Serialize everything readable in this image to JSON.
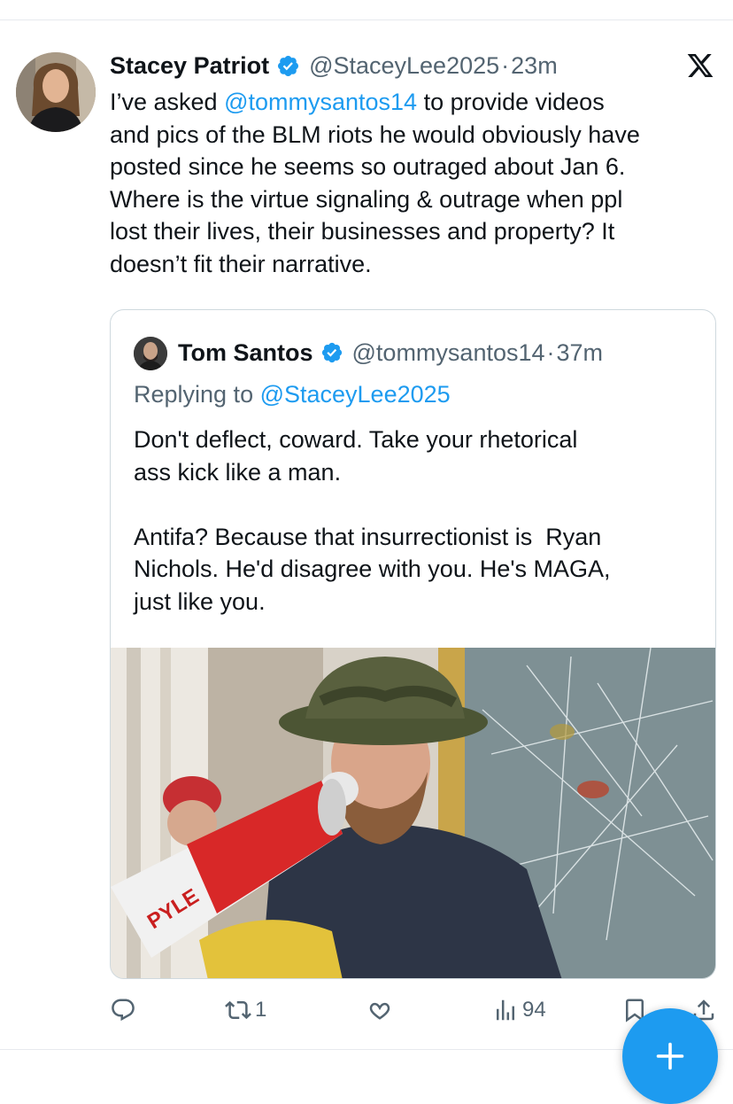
{
  "tweet": {
    "author_name": "Stacey Patriot",
    "author_handle": "@StaceyLee2025",
    "separator": "·",
    "time": "23m",
    "text_before_mention": "I’ve asked ",
    "mention": "@tommysantos14",
    "text_after_mention": " to provide videos\nand pics of the BLM riots he would obviously have\nposted since he seems so outraged about Jan 6.\nWhere is the virtue signaling & outrage when ppl\nlost their lives, their businesses and property? It\ndoesn’t fit their narrative."
  },
  "quoted_tweet": {
    "author_name": "Tom Santos",
    "author_handle": "@tommysantos14",
    "separator": "·",
    "time": "37m",
    "replying_prefix": "Replying to ",
    "replying_handle": "@StaceyLee2025",
    "text": "Don't deflect, coward. Take your rhetorical\nass kick like a man.\n\nAntifa? Because that insurrectionist is  Ryan\nNichols. He'd disagree with you. He's MAGA,\njust like you.",
    "photo_text": "PYLE"
  },
  "actions": {
    "reply_count": "",
    "retweet_count": "1",
    "like_count": "",
    "views_count": "94"
  },
  "icons": {
    "verified": "verified-badge-icon",
    "x_logo": "x-logo-icon",
    "reply": "reply-icon",
    "retweet": "retweet-icon",
    "like": "heart-icon",
    "views": "views-icon",
    "bookmark": "bookmark-icon",
    "share": "share-icon",
    "compose": "plus-icon"
  },
  "colors": {
    "link": "#1d9bf0",
    "verified": "#1d9bf0",
    "secondary_text": "#536471",
    "fab": "#1d9bf0"
  }
}
